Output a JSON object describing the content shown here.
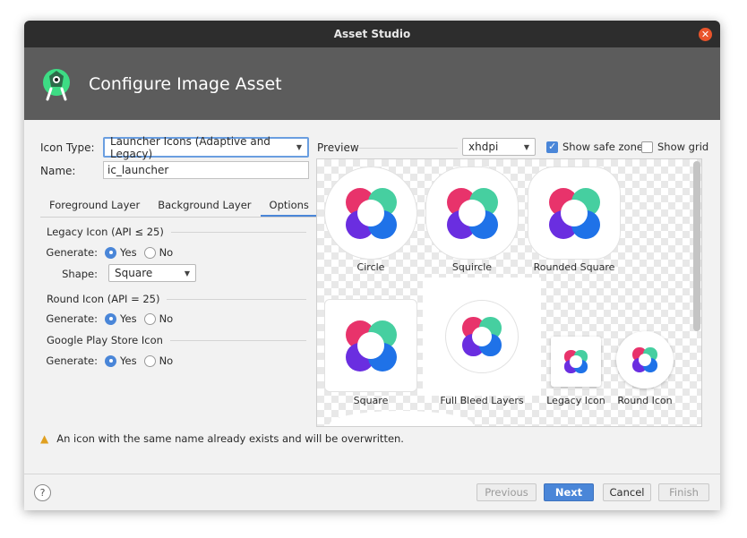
{
  "window": {
    "title": "Asset Studio",
    "close_symbol": "✕"
  },
  "header": {
    "title": "Configure Image Asset",
    "logo_icon": "android-studio-icon"
  },
  "form": {
    "icon_type_label": "Icon Type:",
    "icon_type_value": "Launcher Icons (Adaptive and Legacy)",
    "name_label": "Name:",
    "name_value": "ic_launcher"
  },
  "tabs": [
    {
      "label": "Foreground Layer",
      "active": false
    },
    {
      "label": "Background Layer",
      "active": false
    },
    {
      "label": "Options",
      "active": true
    }
  ],
  "options": {
    "legacy_section": "Legacy Icon (API ≤ 25)",
    "legacy_generate_label": "Generate:",
    "legacy_generate": "Yes",
    "shape_label": "Shape:",
    "shape_value": "Square",
    "round_section": "Round Icon (API = 25)",
    "round_generate_label": "Generate:",
    "round_generate": "Yes",
    "play_section": "Google Play Store Icon",
    "play_generate_label": "Generate:",
    "play_generate": "Yes",
    "yes_label": "Yes",
    "no_label": "No"
  },
  "preview": {
    "label": "Preview",
    "density": "xhdpi",
    "show_safe_zone_label": "Show safe zone",
    "show_safe_zone": true,
    "show_grid_label": "Show grid",
    "show_grid": false,
    "captions": {
      "circle": "Circle",
      "squircle": "Squircle",
      "rounded_square": "Rounded Square",
      "square": "Square",
      "full_bleed": "Full Bleed Layers",
      "legacy": "Legacy Icon",
      "round": "Round Icon"
    },
    "colors": {
      "petal_top_left": "#e8336b",
      "petal_top_right": "#46cfa0",
      "petal_bottom_left": "#6a2ee0",
      "petal_bottom_right": "#1f72e8"
    }
  },
  "warning": {
    "icon": "warning-icon",
    "text": "An icon with the same name already exists and will be overwritten."
  },
  "footer": {
    "help": "?",
    "previous": "Previous",
    "next": "Next",
    "cancel": "Cancel",
    "finish": "Finish"
  }
}
